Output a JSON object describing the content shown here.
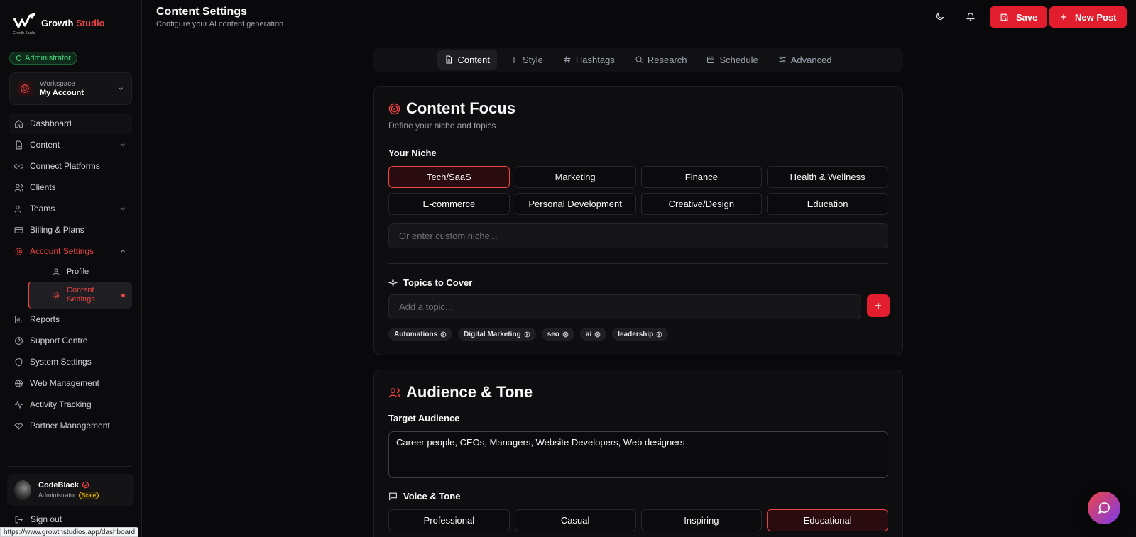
{
  "brand": {
    "name_main": "Growth ",
    "name_accent": "Studio",
    "mark_caption": "Growth Studio"
  },
  "role_badge": "Administrator",
  "workspace": {
    "label": "Workspace",
    "value": "My Account"
  },
  "nav": {
    "dashboard": "Dashboard",
    "content": "Content",
    "connect_platforms": "Connect Platforms",
    "clients": "Clients",
    "teams": "Teams",
    "billing": "Billing & Plans",
    "account_settings": "Account Settings",
    "profile": "Profile",
    "content_settings": "Content Settings",
    "reports": "Reports",
    "support": "Support Centre",
    "system_settings": "System Settings",
    "web_management": "Web Management",
    "activity_tracking": "Activity Tracking",
    "partner_management": "Partner Management"
  },
  "user": {
    "name": "CodeBlack",
    "role": "Administrator",
    "plan": "Scale"
  },
  "signout": "Sign out",
  "status_url": "https://www.growthstudios.app/dashboard",
  "header": {
    "title": "Content Settings",
    "subtitle": "Configure your AI content generation",
    "save_label": "Save",
    "new_post_label": "New Post"
  },
  "tabs": [
    "Content",
    "Style",
    "Hashtags",
    "Research",
    "Schedule",
    "Advanced"
  ],
  "content_focus": {
    "title": "Content Focus",
    "subtitle": "Define your niche and topics",
    "niche_label": "Your Niche",
    "niches": [
      "Tech/SaaS",
      "Marketing",
      "Finance",
      "Health & Wellness",
      "E-commerce",
      "Personal Development",
      "Creative/Design",
      "Education"
    ],
    "selected_niche": "Tech/SaaS",
    "custom_niche_placeholder": "Or enter custom niche...",
    "topics_label": "Topics to Cover",
    "topic_placeholder": "Add a topic...",
    "topics": [
      "Automations",
      "Digital Marketing",
      "seo",
      "ai",
      "leadership"
    ]
  },
  "audience": {
    "title": "Audience & Tone",
    "target_label": "Target Audience",
    "target_value": "Career people, CEOs, Managers, Website Developers, Web designers",
    "voice_label": "Voice & Tone",
    "voices": [
      "Professional",
      "Casual",
      "Inspiring",
      "Educational"
    ],
    "selected_voice": "Educational"
  },
  "colors": {
    "accent": "#e11d2e",
    "background": "#09090b",
    "card": "#0e0e11",
    "success": "#4ade80"
  }
}
